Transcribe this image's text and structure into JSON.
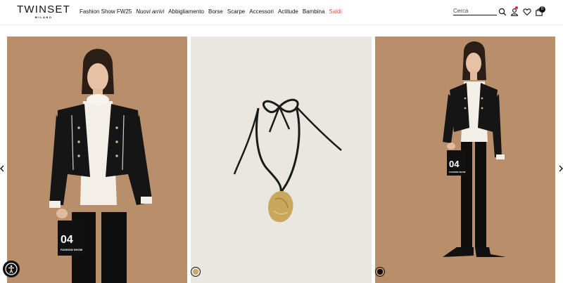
{
  "brand": {
    "name": "TWINSET",
    "sub": "MILANO"
  },
  "nav": {
    "items": [
      {
        "label": "Fashion Show FW25",
        "style": "normal"
      },
      {
        "label": "Nuovi arrivi",
        "style": "italic"
      },
      {
        "label": "Abbigliamento",
        "style": "normal"
      },
      {
        "label": "Borse",
        "style": "normal"
      },
      {
        "label": "Scarpe",
        "style": "normal"
      },
      {
        "label": "Accessori",
        "style": "normal"
      },
      {
        "label": "Actitude",
        "style": "normal"
      },
      {
        "label": "Bambina",
        "style": "normal"
      },
      {
        "label": "Saldi",
        "style": "sale"
      }
    ]
  },
  "search": {
    "placeholder": "Cerca"
  },
  "cart": {
    "count": "0"
  },
  "colors": {
    "sale": "#d6573c",
    "backdrop": "#b98e6a",
    "accent_dot": "#d6246e"
  },
  "products": [
    {
      "sign_number": "04",
      "sign_caption": "FASHION SHOW"
    },
    {
      "sign_number": "",
      "sign_caption": ""
    },
    {
      "sign_number": "04",
      "sign_caption": "FASHION SHOW"
    }
  ],
  "swatches": [
    {
      "color": "#c9a66b"
    },
    {
      "color": "#111111"
    }
  ],
  "icons": [
    "search-icon",
    "user-icon",
    "heart-icon",
    "bag-icon",
    "chevron-left-icon",
    "chevron-right-icon",
    "accessibility-icon"
  ]
}
